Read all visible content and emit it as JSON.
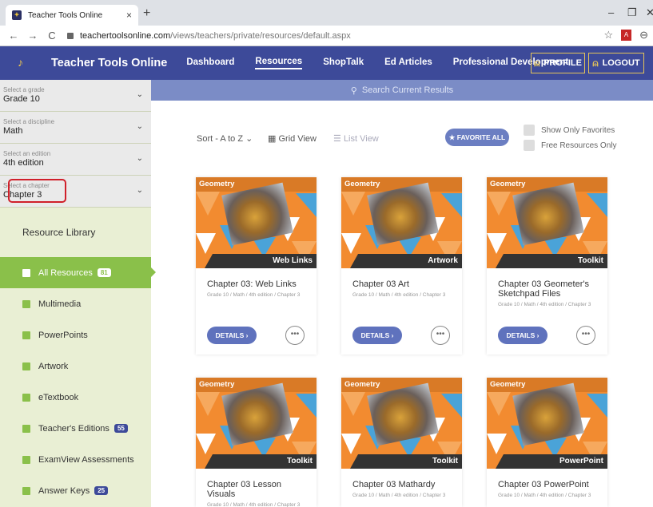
{
  "browser": {
    "tab_title": "Teacher Tools Online",
    "tab_close": "×",
    "new_tab": "+",
    "url_host": "teachertoolsonline.com",
    "url_path": "/views/teachers/private/resources/default.aspx",
    "nav_back": "←",
    "nav_forward": "→",
    "nav_reload": "C",
    "min": "–",
    "max": "❐",
    "close": "✕",
    "star": "☆",
    "pdf": "A",
    "profile": "⊖"
  },
  "header": {
    "brand": "Teacher Tools Online",
    "nav": [
      "Dashboard",
      "Resources",
      "ShopTalk",
      "Ed Articles",
      "Professional Development"
    ],
    "profile": "PROFILE",
    "logout": "LOGOUT"
  },
  "sidebar": {
    "dropdowns": [
      {
        "label": "Select a grade",
        "value": "Grade 10"
      },
      {
        "label": "Select a discipline",
        "value": "Math"
      },
      {
        "label": "Select an edition",
        "value": "4th edition"
      },
      {
        "label": "Select a chapter",
        "value": "Chapter 3"
      }
    ],
    "library_title": "Resource Library",
    "items": [
      {
        "label": "All Resources",
        "badge": "81"
      },
      {
        "label": "Multimedia",
        "badge": ""
      },
      {
        "label": "PowerPoints",
        "badge": ""
      },
      {
        "label": "Artwork",
        "badge": ""
      },
      {
        "label": "eTextbook",
        "badge": ""
      },
      {
        "label": "Teacher's Editions",
        "badge": "55"
      },
      {
        "label": "ExamView Assessments",
        "badge": ""
      },
      {
        "label": "Answer Keys",
        "badge": "25"
      }
    ]
  },
  "search": {
    "label": "Search Current Results"
  },
  "toolbar": {
    "sort": "Sort - A to Z",
    "grid_view": "Grid View",
    "list_view": "List View",
    "favorite_all": "FAVORITE ALL",
    "show_favorites": "Show Only Favorites",
    "free_only": "Free Resources Only"
  },
  "cards": [
    {
      "subject": "Geometry",
      "type": "Web Links",
      "title": "Chapter 03: Web Links",
      "meta": "Grade 10 / Math / 4th edition / Chapter 3",
      "details": "DETAILS ›"
    },
    {
      "subject": "Geometry",
      "type": "Artwork",
      "title": "Chapter 03 Art",
      "meta": "Grade 10 / Math / 4th edition / Chapter 3",
      "details": "DETAILS ›"
    },
    {
      "subject": "Geometry",
      "type": "Toolkit",
      "title": "Chapter 03 Geometer's Sketchpad Files",
      "meta": "Grade 10 / Math / 4th edition / Chapter 3",
      "details": "DETAILS ›"
    },
    {
      "subject": "Geometry",
      "type": "Toolkit",
      "title": "Chapter 03 Lesson Visuals",
      "meta": "Grade 10 / Math / 4th edition / Chapter 3",
      "details": "DETAILS ›"
    },
    {
      "subject": "Geometry",
      "type": "Toolkit",
      "title": "Chapter 03 Mathardy",
      "meta": "Grade 10 / Math / 4th edition / Chapter 3",
      "details": "DETAILS ›"
    },
    {
      "subject": "Geometry",
      "type": "PowerPoint",
      "title": "Chapter 03 PowerPoint",
      "meta": "Grade 10 / Math / 4th edition / Chapter 3",
      "details": "DETAILS ›"
    }
  ],
  "colors": {
    "header": "#3d4a99",
    "accent": "#8ac04a",
    "gold": "#e4c45a",
    "orange": "#f28b30",
    "highlight": "#d0202a"
  }
}
